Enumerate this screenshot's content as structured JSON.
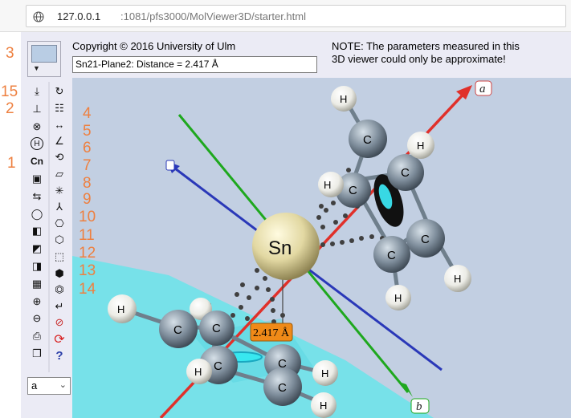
{
  "browser": {
    "url_host": "127.0.0.1",
    "url_rest": ":1081/pfs3000/MolViewer3D/starter.html"
  },
  "header": {
    "copyright": "Copyright © 2016 University of Ulm",
    "measurement_value": "Sn21-Plane2: Distance = 2.417 Å",
    "note_line1": "NOTE: The parameters measured in this",
    "note_line2": "3D viewer could only be approximate!"
  },
  "toolbar": {
    "frame_select_value": "a",
    "left_column_icons": [
      "reset-orientation-icon",
      "hide-hydrogen-icon",
      "close-circle-icon",
      "hydrogen-icon",
      "element-label-icon",
      "clipboard-color-icon",
      "rotate-icon",
      "ring-icon",
      "cube-icon",
      "cube-edit-icon",
      "cube-add-icon",
      "cube-stack-icon",
      "zoom-in-icon",
      "zoom-out-icon",
      "print-icon",
      "copy-icon"
    ],
    "right_column_icons": [
      "rotate-axis-icon",
      "measure-list-icon",
      "distance-icon",
      "angle-icon",
      "torsion-icon",
      "plane-icon",
      "centroid-icon",
      "branch-icon",
      "ring-select-icon",
      "polyhedron-icon",
      "plane-select-icon",
      "ring-hexagon-icon",
      "atom-hex-icon",
      "return-icon",
      "no-cube-icon",
      "refresh-icon",
      "help-icon"
    ],
    "help_glyph": "?",
    "element_glyph": "Cn",
    "hydrogen_glyph": "H"
  },
  "annotations": {
    "n1": "1",
    "n2": "2",
    "n3": "3",
    "n4": "4",
    "n5": "5",
    "n6": "6",
    "n7": "7",
    "n8": "8",
    "n9": "9",
    "n10": "10",
    "n11": "11",
    "n12": "12",
    "n13": "13",
    "n14": "14",
    "n15": "15"
  },
  "viewer": {
    "axis_label_a": "a",
    "axis_label_b": "b",
    "distance_label": "2.417 Å",
    "central_atom": "Sn",
    "carbon": "C",
    "hydrogen": "H",
    "colors": {
      "background": "#c2cfe2",
      "axis_a": "#e0302a",
      "axis_b": "#1ea81e",
      "axis_c": "#2a38b8",
      "plane": "#66e4ea",
      "tin": "#dcd5a0",
      "carbon": "#7c8b98",
      "hydrogen": "#f2f2ee",
      "distance_label_bg": "#f08a18"
    }
  }
}
